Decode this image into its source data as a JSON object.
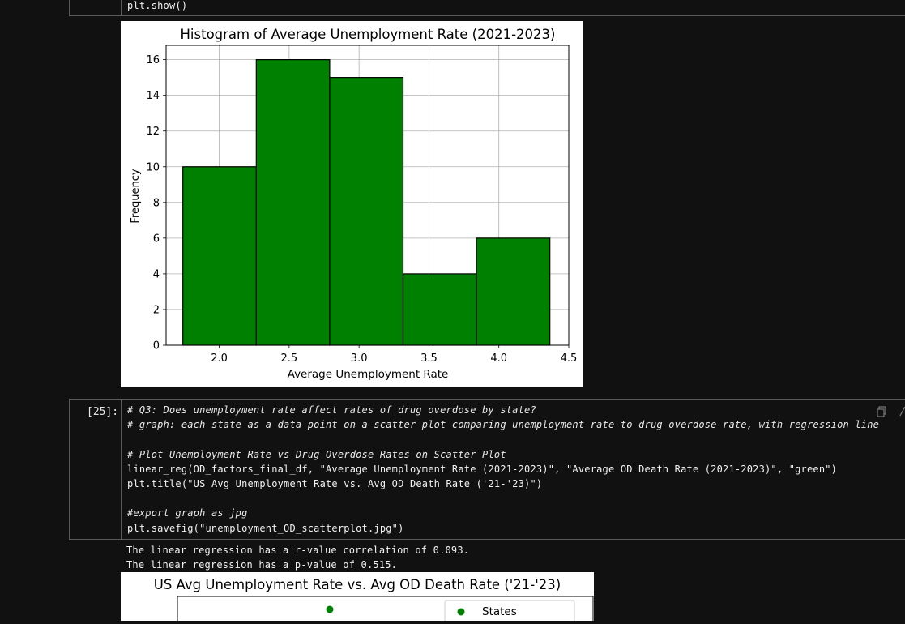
{
  "top_cell": {
    "code_last_line": "plt.show()"
  },
  "histogram": {
    "title": "Histogram of Average Unemployment Rate (2021-2023)",
    "chart_data": {
      "type": "bar",
      "title": "Histogram of Average Unemployment Rate (2021-2023)",
      "xlabel": "Average Unemployment Rate",
      "ylabel": "Frequency",
      "bin_edges": [
        1.74,
        2.265,
        2.79,
        3.315,
        3.84,
        4.365
      ],
      "values": [
        10,
        16,
        15,
        4,
        6
      ],
      "xlim": [
        1.62,
        4.5
      ],
      "ylim": [
        0,
        16.8
      ],
      "xticks": [
        "2.0",
        "2.5",
        "3.0",
        "3.5",
        "4.0",
        "4.5"
      ],
      "yticks": [
        "0",
        "2",
        "4",
        "6",
        "8",
        "10",
        "12",
        "14",
        "16"
      ],
      "bar_color": "#008000",
      "edge_color": "#000000",
      "grid": true
    }
  },
  "cell25": {
    "prompt": "[25]:",
    "lines": [
      "# Q3: Does unemployment rate affect rates of drug overdose by state?",
      "# graph: each state as a data point on a scatter plot comparing unemployment rate to drug overdose rate, with regression line",
      "",
      "# Plot Unemployment Rate vs Drug Overdose Rates on Scatter Plot",
      "linear_reg(OD_factors_final_df, \"Average Unemployment Rate (2021-2023)\", \"Average OD Death Rate (2021-2023)\", \"green\")",
      "plt.title(\"US Avg Unemployment Rate vs. Avg OD Death Rate ('21-'23)\")",
      "",
      "#export graph as jpg",
      "plt.savefig(\"unemployment_OD_scatterplot.jpg\")"
    ]
  },
  "output25": {
    "lines": [
      "The linear regression has a r-value correlation of 0.093.",
      "The linear regression has a p-value of 0.515."
    ]
  },
  "scatter": {
    "title": "US Avg Unemployment Rate vs. Avg OD Death Rate ('21-'23)",
    "legend_label": "States",
    "point_color": "#008000"
  },
  "icons": [
    "copy-icon",
    "arrow-up-icon"
  ]
}
